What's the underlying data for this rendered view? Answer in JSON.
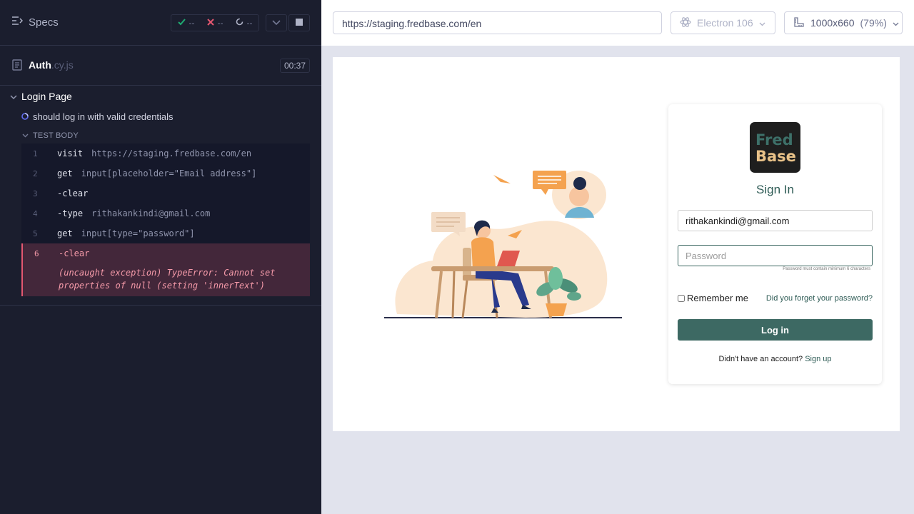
{
  "reporter": {
    "specs_label": "Specs",
    "stats": {
      "passed": "--",
      "failed": "--",
      "pending": "--"
    },
    "spec": {
      "name": "Auth",
      "ext": ".cy.js",
      "duration": "00:37"
    },
    "suite_title": "Login Page",
    "test_title": "should log in with valid credentials",
    "test_body_label": "TEST BODY",
    "commands": [
      {
        "num": "1",
        "name": "visit",
        "message": "https://staging.fredbase.com/en"
      },
      {
        "num": "2",
        "name": "get",
        "message": "input[placeholder=\"Email address\"]"
      },
      {
        "num": "3",
        "name": "-clear",
        "message": ""
      },
      {
        "num": "4",
        "name": "-type",
        "message": "rithakankindi@gmail.com"
      },
      {
        "num": "5",
        "name": "get",
        "message": "input[type=\"password\"]"
      },
      {
        "num": "6",
        "name": "-clear",
        "message": ""
      }
    ],
    "error": {
      "line1": "(uncaught exception)  TypeError: Cannot set",
      "line2": "properties of null (setting 'innerText')"
    }
  },
  "topbar": {
    "url": "https://staging.fredbase.com/en",
    "browser": "Electron 106",
    "viewport": "1000x660",
    "zoom": "(79%)"
  },
  "app": {
    "logo_line1": "Fred",
    "logo_line2": "Base",
    "title": "Sign In",
    "email_value": "rithakankindi@gmail.com",
    "password_placeholder": "Password",
    "password_hint": "Password must contain minimum 6 characters",
    "remember_label": "Remember me",
    "forgot_link": "Did you forget your password?",
    "login_button": "Log in",
    "signup_prompt": "Didn't have an account?",
    "signup_link": "Sign up"
  },
  "colors": {
    "reporter_bg": "#1b1e2e",
    "failed_bg": "#43273a",
    "failed_text": "#f59aa9",
    "brand_green": "#3d6963",
    "aut_bg": "#e1e3ed"
  }
}
